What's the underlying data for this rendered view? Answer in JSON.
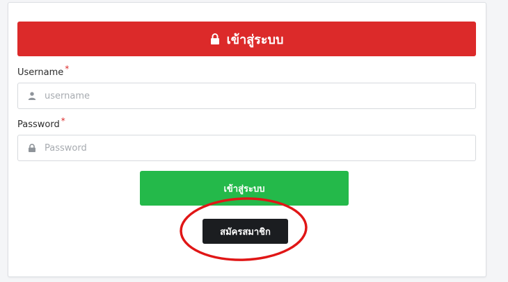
{
  "header": {
    "title": "เข้าสู่ระบบ",
    "color": "#dc2a2a"
  },
  "form": {
    "username_label": "Username",
    "username_required": "*",
    "username_placeholder": "username",
    "password_label": "Password",
    "password_required": "*",
    "password_placeholder": "Password"
  },
  "buttons": {
    "login_label": "เข้าสู่ระบบ",
    "login_color": "#24b94a",
    "register_label": "สมัครสมาชิก",
    "register_color": "#1b1d20"
  },
  "annotation": {
    "shape": "ellipse",
    "color": "#e01616"
  }
}
